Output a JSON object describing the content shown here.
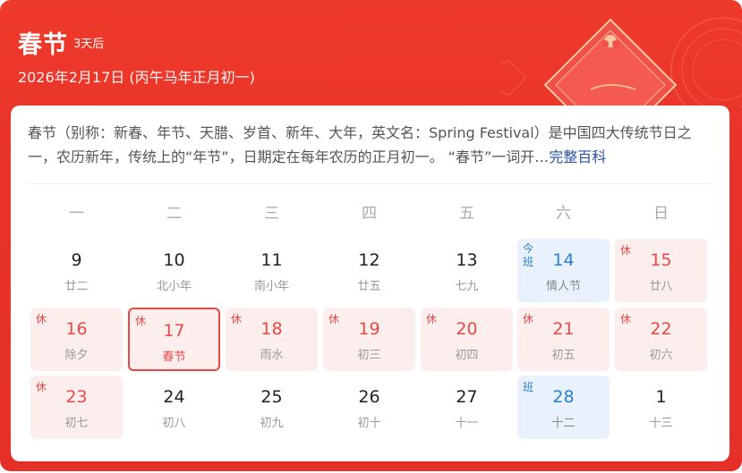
{
  "header": {
    "title": "春节",
    "countdown": "3天后",
    "date": "2026年2月17日 (丙午马年正月初一)"
  },
  "description": {
    "text": "春节（别称：新春、年节、天腊、岁首、新年、大年，英文名：Spring Festival）是中国四大传统节日之一，农历新年，传统上的“年节”，日期定在每年农历的正月初一。 “春节”一词开…",
    "link": "完整百科"
  },
  "weekdays": [
    "一",
    "二",
    "三",
    "四",
    "五",
    "六",
    "日"
  ],
  "days": [
    {
      "num": "9",
      "sub": "廿二",
      "type": "normal",
      "tag": ""
    },
    {
      "num": "10",
      "sub": "北小年",
      "type": "normal",
      "tag": ""
    },
    {
      "num": "11",
      "sub": "南小年",
      "type": "normal",
      "tag": ""
    },
    {
      "num": "12",
      "sub": "廿五",
      "type": "normal",
      "tag": ""
    },
    {
      "num": "13",
      "sub": "七九",
      "type": "normal",
      "tag": ""
    },
    {
      "num": "14",
      "sub": "情人节",
      "type": "work",
      "tag": "今\n班"
    },
    {
      "num": "15",
      "sub": "廿八",
      "type": "holiday",
      "tag": "休"
    },
    {
      "num": "16",
      "sub": "除夕",
      "type": "holiday",
      "tag": "休"
    },
    {
      "num": "17",
      "sub": "春节",
      "type": "selected",
      "tag": "休"
    },
    {
      "num": "18",
      "sub": "雨水",
      "type": "holiday",
      "tag": "休"
    },
    {
      "num": "19",
      "sub": "初三",
      "type": "holiday",
      "tag": "休"
    },
    {
      "num": "20",
      "sub": "初四",
      "type": "holiday",
      "tag": "休"
    },
    {
      "num": "21",
      "sub": "初五",
      "type": "holiday",
      "tag": "休"
    },
    {
      "num": "22",
      "sub": "初六",
      "type": "holiday",
      "tag": "休"
    },
    {
      "num": "23",
      "sub": "初七",
      "type": "holiday",
      "tag": "休"
    },
    {
      "num": "24",
      "sub": "初八",
      "type": "normal",
      "tag": ""
    },
    {
      "num": "25",
      "sub": "初九",
      "type": "normal",
      "tag": ""
    },
    {
      "num": "26",
      "sub": "初十",
      "type": "normal",
      "tag": ""
    },
    {
      "num": "27",
      "sub": "十一",
      "type": "normal",
      "tag": ""
    },
    {
      "num": "28",
      "sub": "十二",
      "type": "work",
      "tag": "班"
    },
    {
      "num": "1",
      "sub": "十三",
      "type": "normal",
      "tag": ""
    }
  ],
  "colors": {
    "header_red": "#e8322a",
    "holiday_red": "#e94a45",
    "holiday_bg": "#fdeeee",
    "work_blue": "#2a7fd4",
    "work_bg": "#e8f1fc"
  }
}
